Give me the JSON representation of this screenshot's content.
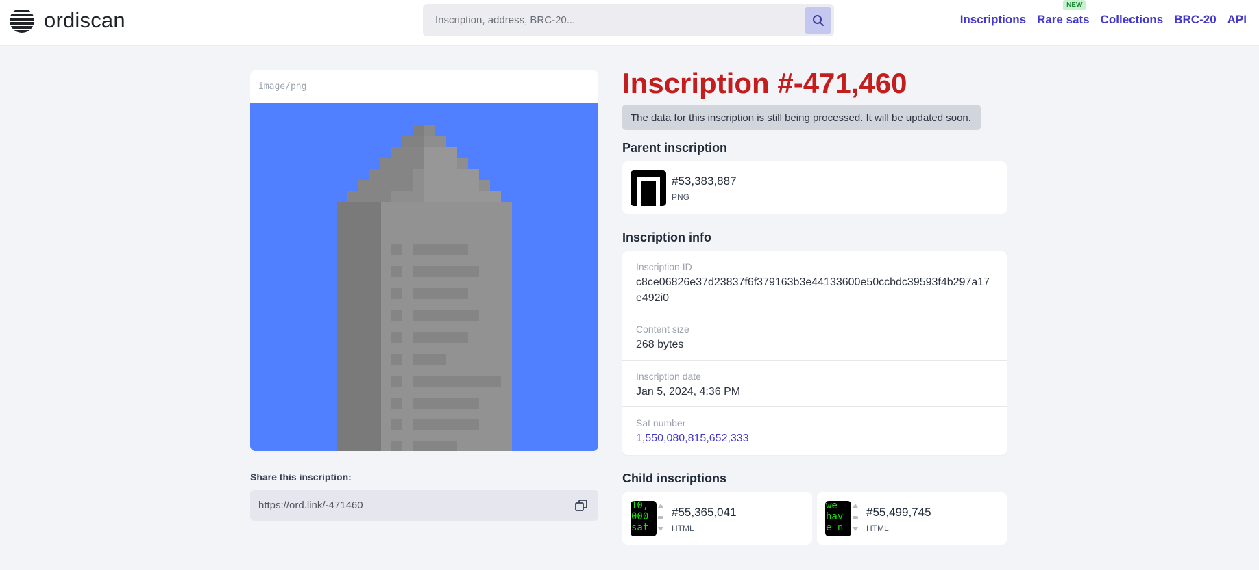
{
  "header": {
    "logo_text": "ordiscan",
    "search_placeholder": "Inscription, address, BRC-20...",
    "nav": [
      {
        "label": "Inscriptions"
      },
      {
        "label": "Rare sats",
        "badge": "NEW"
      },
      {
        "label": "Collections"
      },
      {
        "label": "BRC-20"
      },
      {
        "label": "API"
      }
    ]
  },
  "preview": {
    "mime_type": "image/png"
  },
  "share": {
    "label": "Share this inscription:",
    "url": "https://ord.link/-471460"
  },
  "inscription": {
    "title": "Inscription #-471,460",
    "notice": "The data for this inscription is still being processed. It will be updated soon."
  },
  "parent": {
    "heading": "Parent inscription",
    "number": "#53,383,887",
    "type": "PNG"
  },
  "info": {
    "heading": "Inscription info",
    "rows": [
      {
        "label": "Inscription ID",
        "value": "c8ce06826e37d23837f6f379163b3e44133600e50ccbdc39593f4b297a17e492i0"
      },
      {
        "label": "Content size",
        "value": "268 bytes"
      },
      {
        "label": "Inscription date",
        "value": "Jan 5, 2024, 4:36 PM"
      },
      {
        "label": "Sat number",
        "value": "1,550,080,815,652,333"
      }
    ]
  },
  "children": {
    "heading": "Child inscriptions",
    "items": [
      {
        "number": "#55,365,041",
        "type": "HTML",
        "preview": [
          "10,",
          "000",
          "sat"
        ]
      },
      {
        "number": "#55,499,745",
        "type": "HTML",
        "preview": [
          "we",
          "hav",
          "e n"
        ]
      }
    ]
  },
  "colors": {
    "accent": "#4338ca",
    "title_red": "#c31d1d",
    "preview_bg": "#5080ff",
    "badge_bg": "#c6f2cf"
  }
}
